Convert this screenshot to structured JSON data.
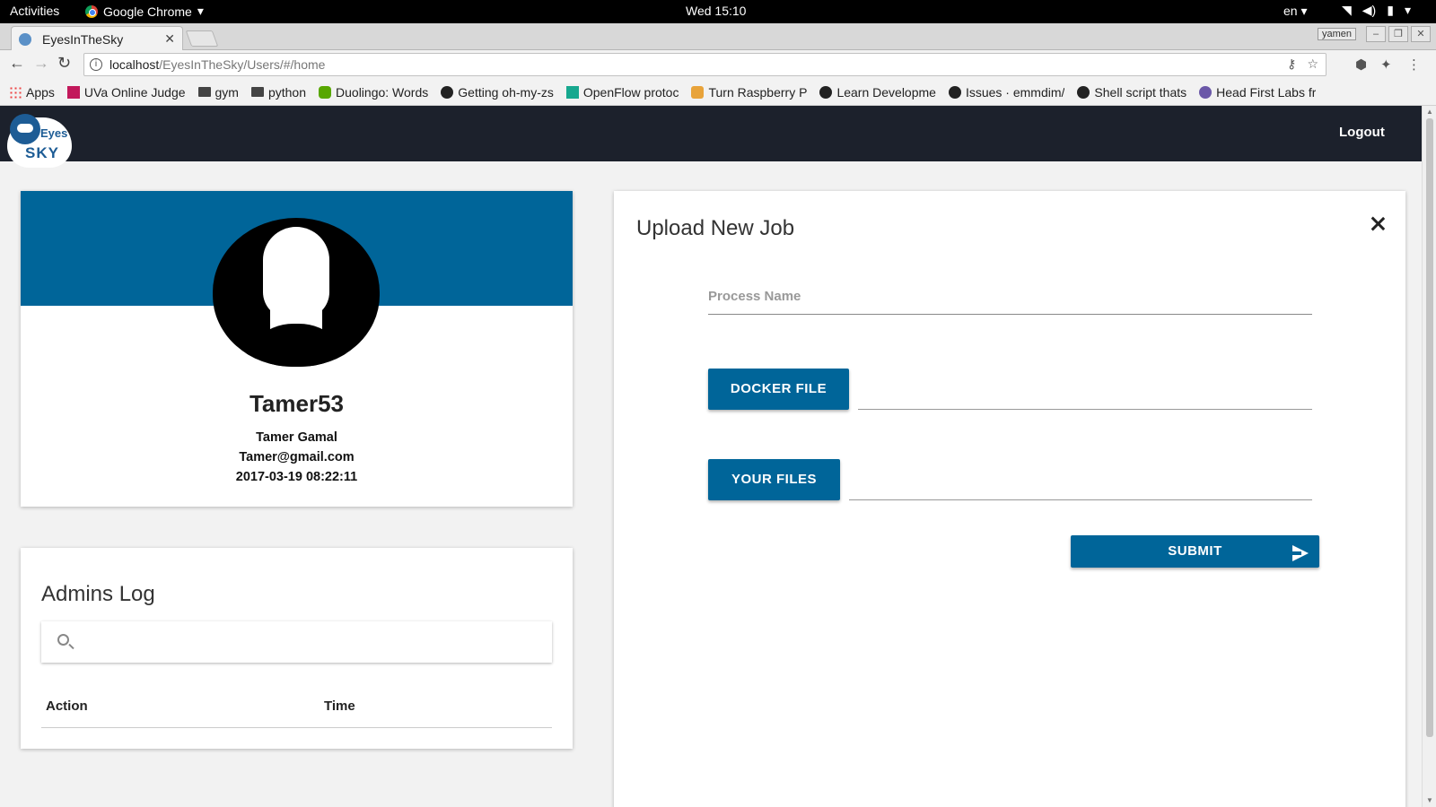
{
  "system": {
    "activities": "Activities",
    "app_name": "Google Chrome",
    "clock": "Wed 15:10",
    "lang": "en"
  },
  "browser": {
    "tab_title": "EyesInTheSky",
    "profile_name": "yamen",
    "url_host": "localhost",
    "url_path": "/EyesInTheSky/Users/#/home"
  },
  "bookmarks": [
    {
      "label": "Apps",
      "icon": "apps-grid-icon"
    },
    {
      "label": "UVa Online Judge",
      "icon": "uva-icon"
    },
    {
      "label": "gym",
      "icon": "folder-icon"
    },
    {
      "label": "python",
      "icon": "folder-icon"
    },
    {
      "label": "Duolingo: Words",
      "icon": "duolingo-icon"
    },
    {
      "label": "Getting oh-my-zs",
      "icon": "github-icon"
    },
    {
      "label": "OpenFlow protoc",
      "icon": "openflow-icon"
    },
    {
      "label": "Turn Raspberry P",
      "icon": "raspberry-icon"
    },
    {
      "label": "Learn Developme",
      "icon": "github-icon"
    },
    {
      "label": "Issues · emmdim/",
      "icon": "github-icon"
    },
    {
      "label": "Shell script thats",
      "icon": "github-icon"
    },
    {
      "label": "Head First Labs fr",
      "icon": "headfirst-icon"
    }
  ],
  "nav": {
    "logo_eyes": "Eyes",
    "logo_sky": "SKY",
    "logout_label": "Logout"
  },
  "profile": {
    "username": "Tamer53",
    "full_name": "Tamer Gamal",
    "email": "Tamer@gmail.com",
    "joined": "2017-03-19 08:22:11"
  },
  "admins_log": {
    "title": "Admins Log",
    "search_placeholder": "",
    "columns": [
      "Action",
      "Time"
    ]
  },
  "upload": {
    "title": "Upload New Job",
    "process_name_placeholder": "Process Name",
    "docker_file_label": "DOCKER FILE",
    "your_files_label": "YOUR FILES",
    "submit_label": "SUBMIT"
  },
  "colors": {
    "primary": "#006599",
    "navbar": "#1c212c"
  }
}
